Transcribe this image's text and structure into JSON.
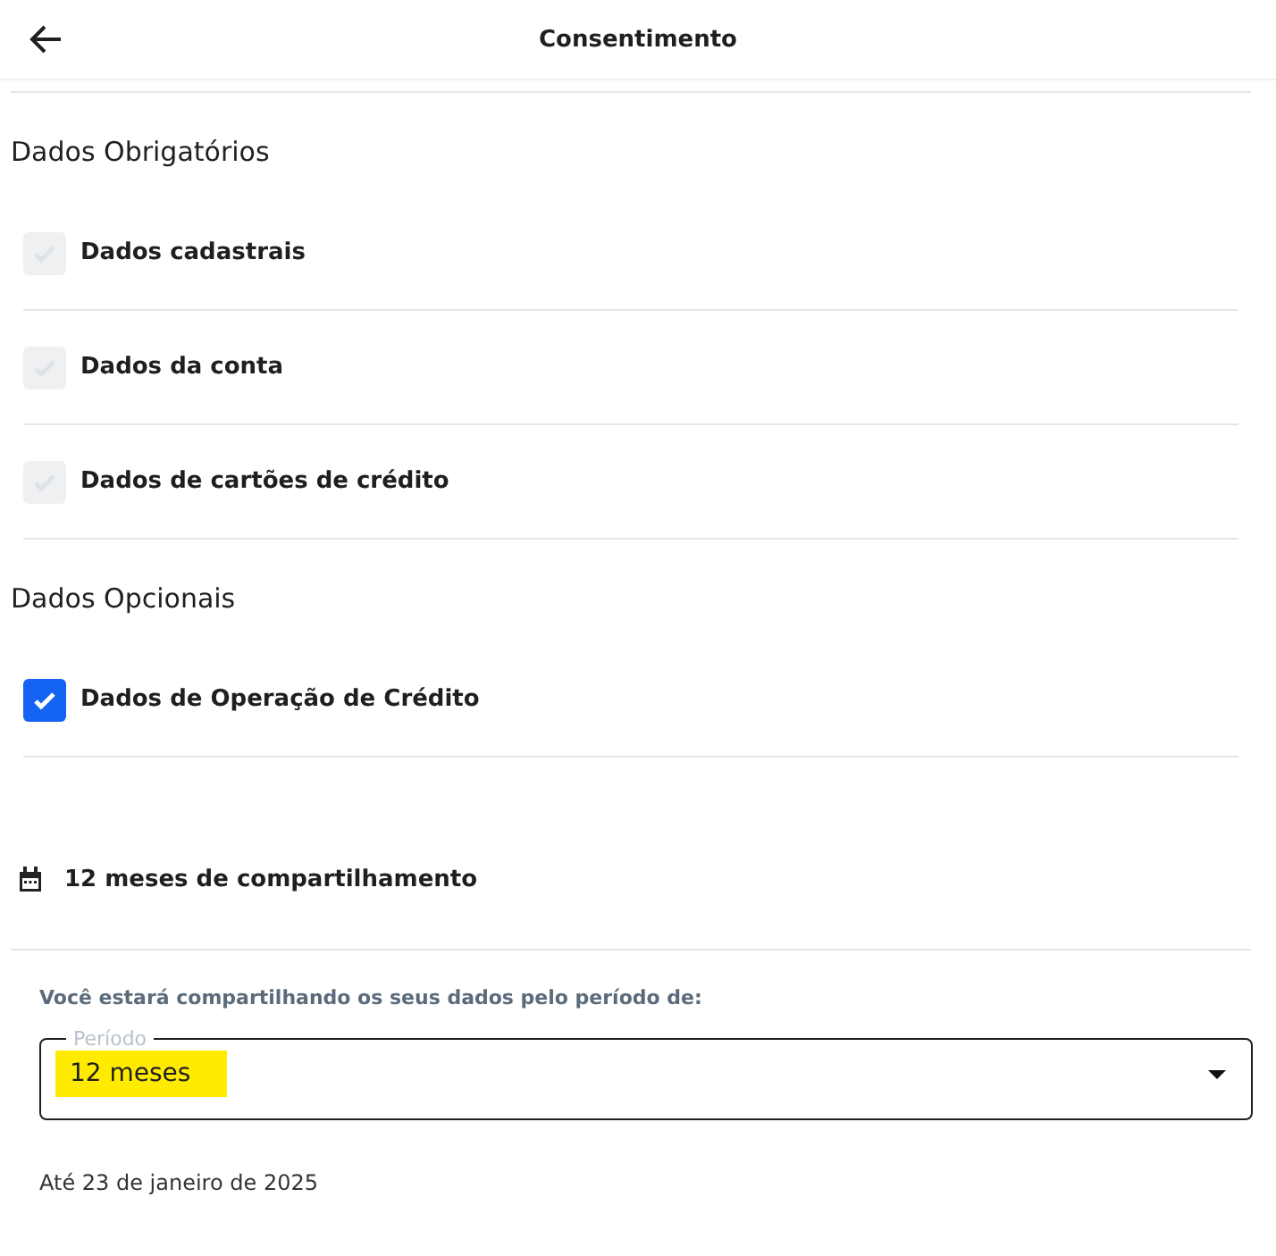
{
  "header": {
    "title": "Consentimento"
  },
  "sections": [
    {
      "title": "Dados Obrigatórios",
      "items": [
        {
          "label": "Dados cadastrais",
          "checked": true,
          "disabled": true
        },
        {
          "label": "Dados da conta",
          "checked": true,
          "disabled": true
        },
        {
          "label": "Dados de cartões de crédito",
          "checked": true,
          "disabled": true
        }
      ]
    },
    {
      "title": "Dados Opcionais",
      "items": [
        {
          "label": "Dados de Operação de Crédito",
          "checked": true,
          "disabled": false
        }
      ]
    }
  ],
  "period_summary": "12 meses de compartilhamento",
  "period_prompt": "Você estará compartilhando os seus dados pelo período de:",
  "period_select": {
    "label": "Período",
    "value": "12 meses",
    "highlighted": true
  },
  "end_date": "Até 23 de janeiro de 2025"
}
